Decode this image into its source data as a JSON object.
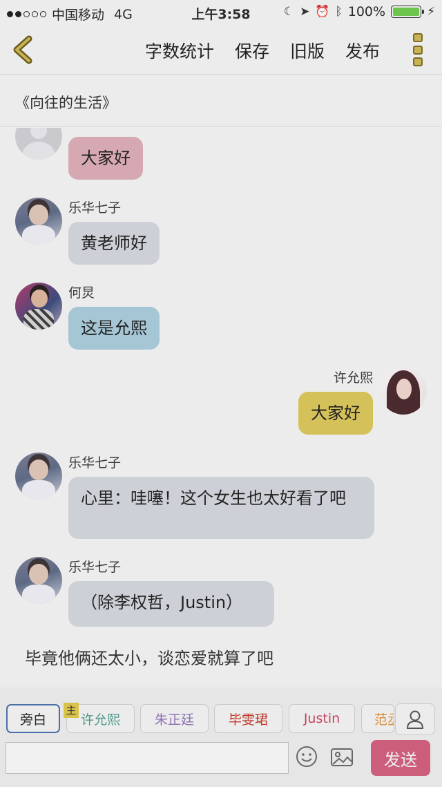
{
  "status_bar": {
    "carrier": "中国移动",
    "network": "4G",
    "time": "上午3:58",
    "battery": "100%"
  },
  "header": {
    "actions": [
      "字数统计",
      "保存",
      "旧版",
      "发布"
    ]
  },
  "story": {
    "title": "《向往的生活》"
  },
  "messages": [
    {
      "side": "left",
      "sender": "",
      "text": "大家好",
      "color": "#d6a9b2"
    },
    {
      "side": "left",
      "sender": "乐华七子",
      "text": "黄老师好",
      "color": "#cdd0d6"
    },
    {
      "side": "left",
      "sender": "何炅",
      "text": "这是允熙",
      "color": "#a5c6d5"
    },
    {
      "side": "right",
      "sender": "许允熙",
      "text": "大家好",
      "color": "#d5c159"
    },
    {
      "side": "left",
      "sender": "乐华七子",
      "text": "心里：哇噻！这个女生也太好看了吧",
      "color": "#cdd0d6"
    },
    {
      "side": "left",
      "sender": "乐华七子",
      "text": "（除李权哲，Justin）",
      "color": "#cdd0d6"
    }
  ],
  "narration": "毕竟他俩还太小，谈恋爱就算了吧",
  "roles": {
    "host_badge": "主",
    "items": [
      {
        "label": "旁白",
        "color": "#2b2b2b"
      },
      {
        "label": "许允熙",
        "color": "#4f9a8c"
      },
      {
        "label": "朱正廷",
        "color": "#8c72b0"
      },
      {
        "label": "毕雯珺",
        "color": "#c0392b"
      },
      {
        "label": "Justin",
        "color": "#c2455e"
      },
      {
        "label": "范丞丞",
        "color": "#d98a3a"
      }
    ]
  },
  "composer": {
    "placeholder": "",
    "send_label": "发送"
  }
}
